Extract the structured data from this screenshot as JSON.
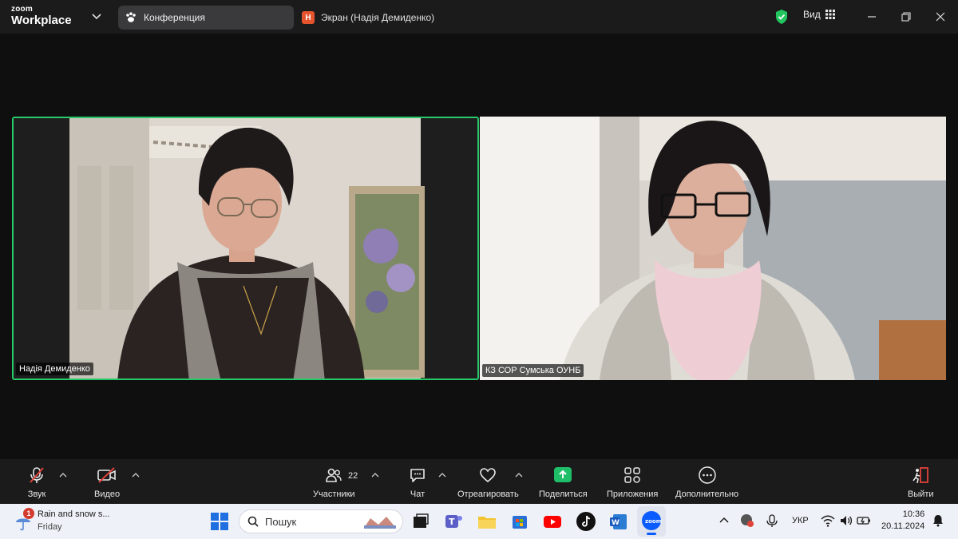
{
  "app": {
    "logo_line1": "zoom",
    "logo_line2": "Workplace"
  },
  "tabs": [
    {
      "label": "Конференция"
    },
    {
      "badge": "Н",
      "label": "Экран (Надія Демиденко)"
    }
  ],
  "header": {
    "view_label": "Вид"
  },
  "participants_view": [
    {
      "name": "Надія Демиденко"
    },
    {
      "name": "КЗ СОР Сумська ОУНБ"
    }
  ],
  "toolbar": {
    "audio_label": "Звук",
    "video_label": "Видео",
    "participants_label": "Участники",
    "participants_count": "22",
    "chat_label": "Чат",
    "react_label": "Отреагировать",
    "share_label": "Поделиться",
    "apps_label": "Приложения",
    "more_label": "Дополнительно",
    "leave_label": "Выйти"
  },
  "taskbar": {
    "weather_text": "Rain and snow s...",
    "weather_day": "Friday",
    "notification_count": "1",
    "search_placeholder": "Пошук",
    "language": "УКР",
    "time": "10:36",
    "date": "20.11.2024"
  },
  "colors": {
    "active_speaker_border": "#27c96b",
    "share_green": "#1fbf6a",
    "toolbar_bg": "#1b1b1c",
    "leave_red": "#e0433a"
  }
}
